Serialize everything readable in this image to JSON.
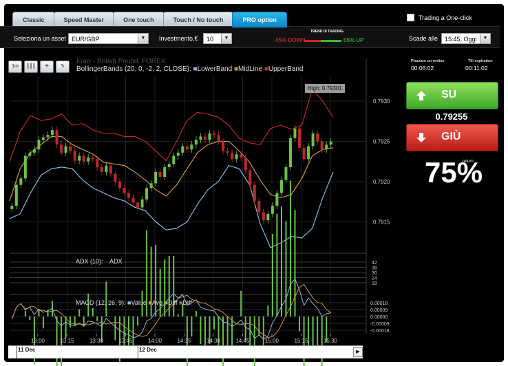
{
  "tabs": [
    "Classic",
    "Speed Master",
    "One touch",
    "Touch / No touch",
    "PRO option"
  ],
  "active_tab": "PRO option",
  "one_click": {
    "label": "Trading a One-click"
  },
  "toolbar": {
    "asset_label": "Seleziona un asset",
    "asset_value": "EUR/GBP",
    "invest_label": "Investmento,€",
    "invest_value": "10",
    "trend_title": "TREND DI TRADING",
    "trend_down": "45% DOWN",
    "trend_up": "55% UP",
    "trend_up_pct": 55,
    "expiry_label": "Scade alle",
    "expiry_value": "15:45, Oggi"
  },
  "chart": {
    "title": "Euro - British Pound, FOREX",
    "bb_label": "BollingerBands (20, 0, -2, 2, CLOSE):",
    "legend": [
      "LowerBand",
      "MidLine",
      "UpperBand"
    ],
    "high_tooltip": "High: 0.79301",
    "adx_label": "ADX (10):",
    "adx_name": "ADX",
    "macd_label": "MACD (12, 26, 9):",
    "macd_legend": [
      "Value",
      "Avg",
      "Diff",
      "Diff"
    ],
    "tool_buttons": [
      "1m",
      "candles",
      "crosshair",
      "wrench"
    ],
    "time_ticks": [
      "13:00",
      "13:15",
      "13:30",
      "13:45",
      "14:00",
      "14:15",
      "14:30",
      "14:45",
      "15:00",
      "15:15",
      "15:30"
    ],
    "scroll_dates": [
      "11 Dec",
      "12 Dec"
    ]
  },
  "chart_data": {
    "type": "line",
    "price_ticks": [
      0.793,
      0.7925,
      0.792,
      0.7915
    ],
    "price_labels": [
      "0.7930",
      "0.7925",
      "0.7920",
      "0.7915"
    ],
    "ylim": [
      0.79118,
      0.79335
    ],
    "adx_ticks": [
      "42",
      "36",
      "30",
      "24",
      "18"
    ],
    "macd_ticks": [
      "0.00018",
      "0.00009",
      "0.00000",
      "-0.00009",
      "-0.00018"
    ],
    "macd_ylim": [
      -0.00018,
      0.00018
    ],
    "x": [
      "12:55",
      "13:00",
      "13:05",
      "13:10",
      "13:15",
      "13:20",
      "13:25",
      "13:30",
      "13:35",
      "13:40",
      "13:45",
      "13:50",
      "13:55",
      "14:00",
      "14:05",
      "14:10",
      "14:15",
      "14:20",
      "14:25",
      "14:30",
      "14:35",
      "14:40",
      "14:45",
      "14:50",
      "14:55",
      "15:00",
      "15:05",
      "15:10",
      "15:15",
      "15:20",
      "15:25",
      "15:30"
    ],
    "series": [
      {
        "name": "UpperBand",
        "color": "#c0282a",
        "values": [
          0.79225,
          0.79262,
          0.79282,
          0.79276,
          0.79278,
          0.79284,
          0.7927,
          0.79272,
          0.79264,
          0.7926,
          0.7926,
          0.79256,
          0.79256,
          0.7925,
          0.79238,
          0.79226,
          0.7925,
          0.79276,
          0.79286,
          0.79284,
          0.7928,
          0.7927,
          0.79254,
          0.79248,
          0.79246,
          0.79266,
          0.7927,
          0.79265,
          0.7927,
          0.79315,
          0.793,
          0.7928
        ]
      },
      {
        "name": "MidLine",
        "color": "#c89a3a",
        "values": [
          0.79176,
          0.79216,
          0.79236,
          0.79246,
          0.79256,
          0.79256,
          0.79246,
          0.7924,
          0.79234,
          0.79224,
          0.79222,
          0.7922,
          0.79212,
          0.79202,
          0.7919,
          0.79182,
          0.79196,
          0.79216,
          0.79236,
          0.79246,
          0.7925,
          0.7925,
          0.79238,
          0.79224,
          0.79202,
          0.79184,
          0.7918,
          0.79184,
          0.79204,
          0.79232,
          0.7924,
          0.79242
        ]
      },
      {
        "name": "LowerBand",
        "color": "#8cb8dc",
        "values": [
          0.79154,
          0.7916,
          0.79186,
          0.79208,
          0.79216,
          0.79218,
          0.79216,
          0.79202,
          0.79192,
          0.79186,
          0.7918,
          0.79176,
          0.79168,
          0.79164,
          0.7915,
          0.7914,
          0.79142,
          0.7915,
          0.79172,
          0.7919,
          0.792,
          0.7922,
          0.79216,
          0.79196,
          0.79148,
          0.79118,
          0.79124,
          0.79132,
          0.7913,
          0.79142,
          0.7918,
          0.79212
        ]
      }
    ],
    "candles": {
      "color_up": "#6ac24a",
      "color_down": "#c0282a",
      "close": [
        0.7917,
        0.79196,
        0.79204,
        0.79232,
        0.79236,
        0.7924,
        0.79252,
        0.79255,
        0.79258,
        0.79264,
        0.79246,
        0.79236,
        0.79244,
        0.79238,
        0.79226,
        0.79232,
        0.79225,
        0.7923,
        0.79228,
        0.79218,
        0.79212,
        0.7922,
        0.7921,
        0.792,
        0.79192,
        0.79186,
        0.7918,
        0.79174,
        0.79168,
        0.79178,
        0.79192,
        0.79198,
        0.79212,
        0.79206,
        0.79218,
        0.79222,
        0.79232,
        0.79236,
        0.79244,
        0.7924,
        0.79246,
        0.79252,
        0.79256,
        0.79252,
        0.7926,
        0.79258,
        0.7925,
        0.79238,
        0.79236,
        0.79228,
        0.79234,
        0.7923,
        0.79214,
        0.79196,
        0.79176,
        0.79162,
        0.79152,
        0.7916,
        0.7917,
        0.79186,
        0.79202,
        0.79218,
        0.79254,
        0.79266,
        0.79242,
        0.79228,
        0.79244,
        0.7926,
        0.7925,
        0.7924,
        0.79246,
        0.7925
      ]
    }
  }
}
